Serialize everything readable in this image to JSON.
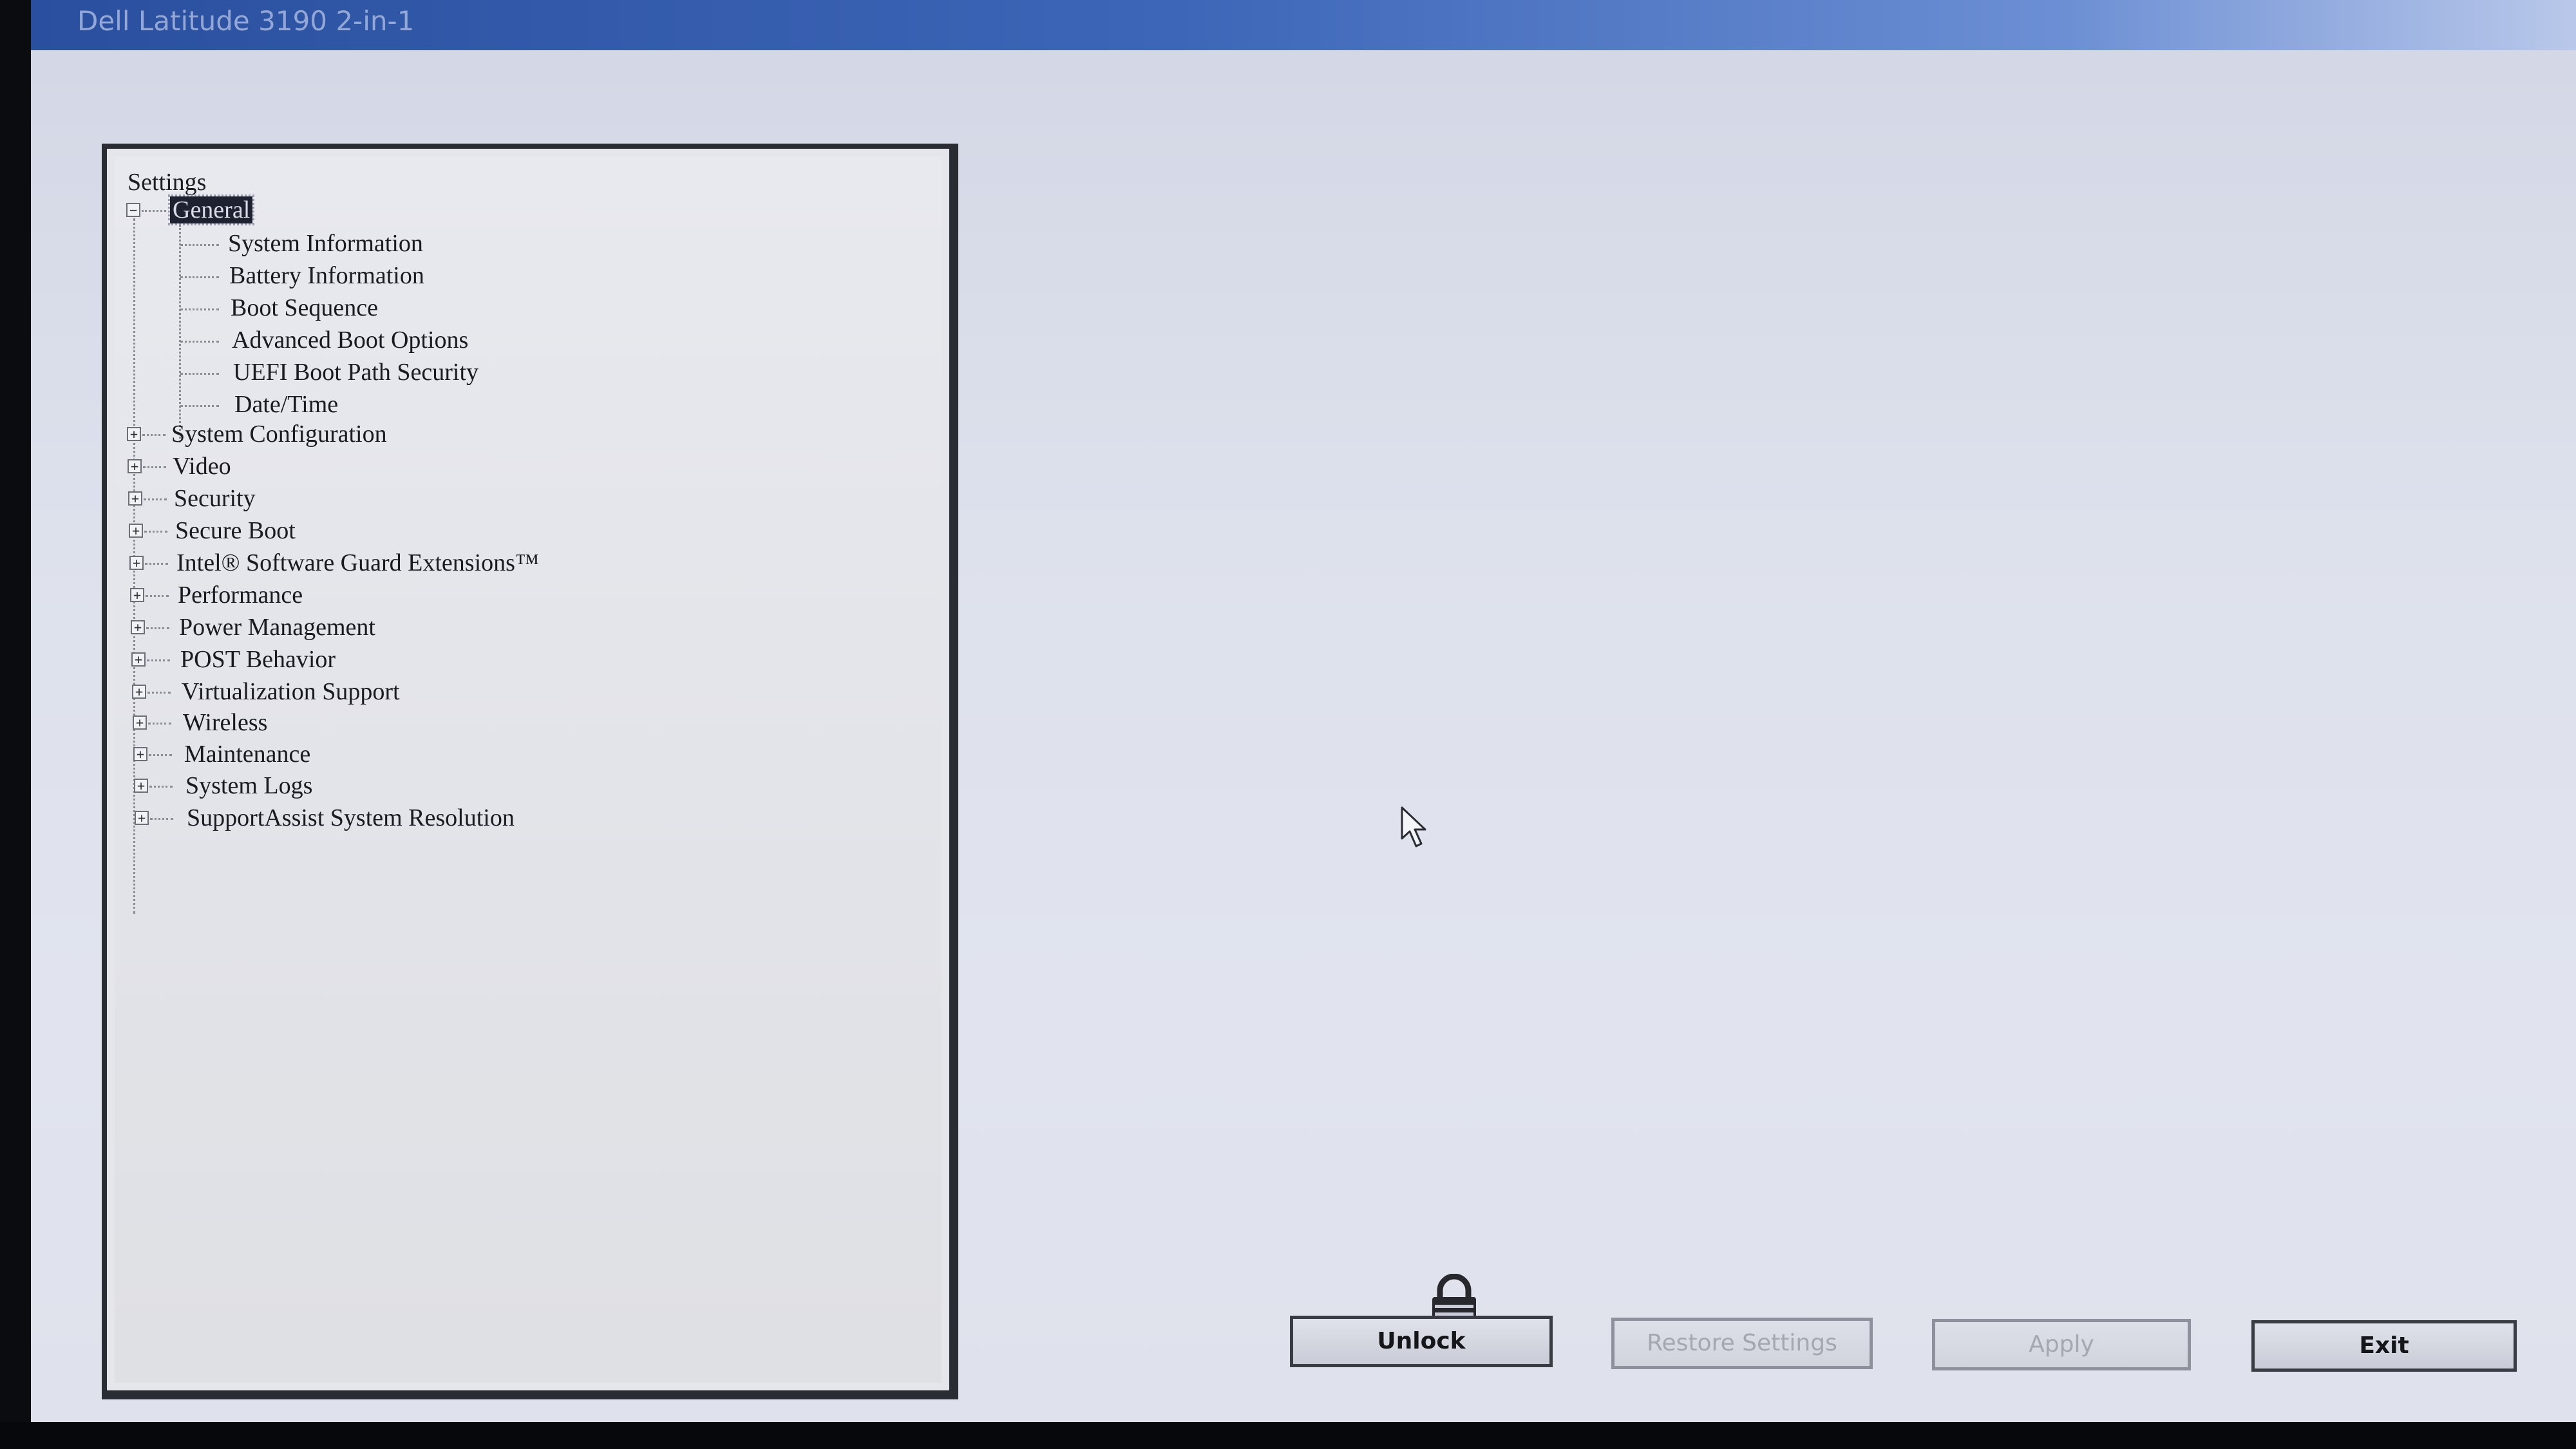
{
  "window": {
    "title": "Dell Latitude 3190 2-in-1"
  },
  "tree": {
    "root_label": "Settings",
    "general": {
      "label": "General",
      "children": [
        "System Information",
        "Battery Information",
        "Boot Sequence",
        "Advanced Boot Options",
        "UEFI Boot Path Security",
        "Date/Time"
      ]
    },
    "collapsed_items": [
      "System Configuration",
      "Video",
      "Security",
      "Secure Boot",
      "Intel® Software Guard Extensions™",
      "Performance",
      "Power Management",
      "POST Behavior",
      "Virtualization Support",
      "Wireless",
      "Maintenance",
      "System Logs",
      "SupportAssist System Resolution"
    ]
  },
  "buttons": {
    "unlock": "Unlock",
    "restore": "Restore Settings",
    "apply": "Apply",
    "exit": "Exit"
  },
  "icons": {
    "lock": "padlock-icon",
    "cursor": "mouse-pointer-icon"
  },
  "colors": {
    "title_bar": "#3d66b8",
    "selection": "#1e2230"
  }
}
